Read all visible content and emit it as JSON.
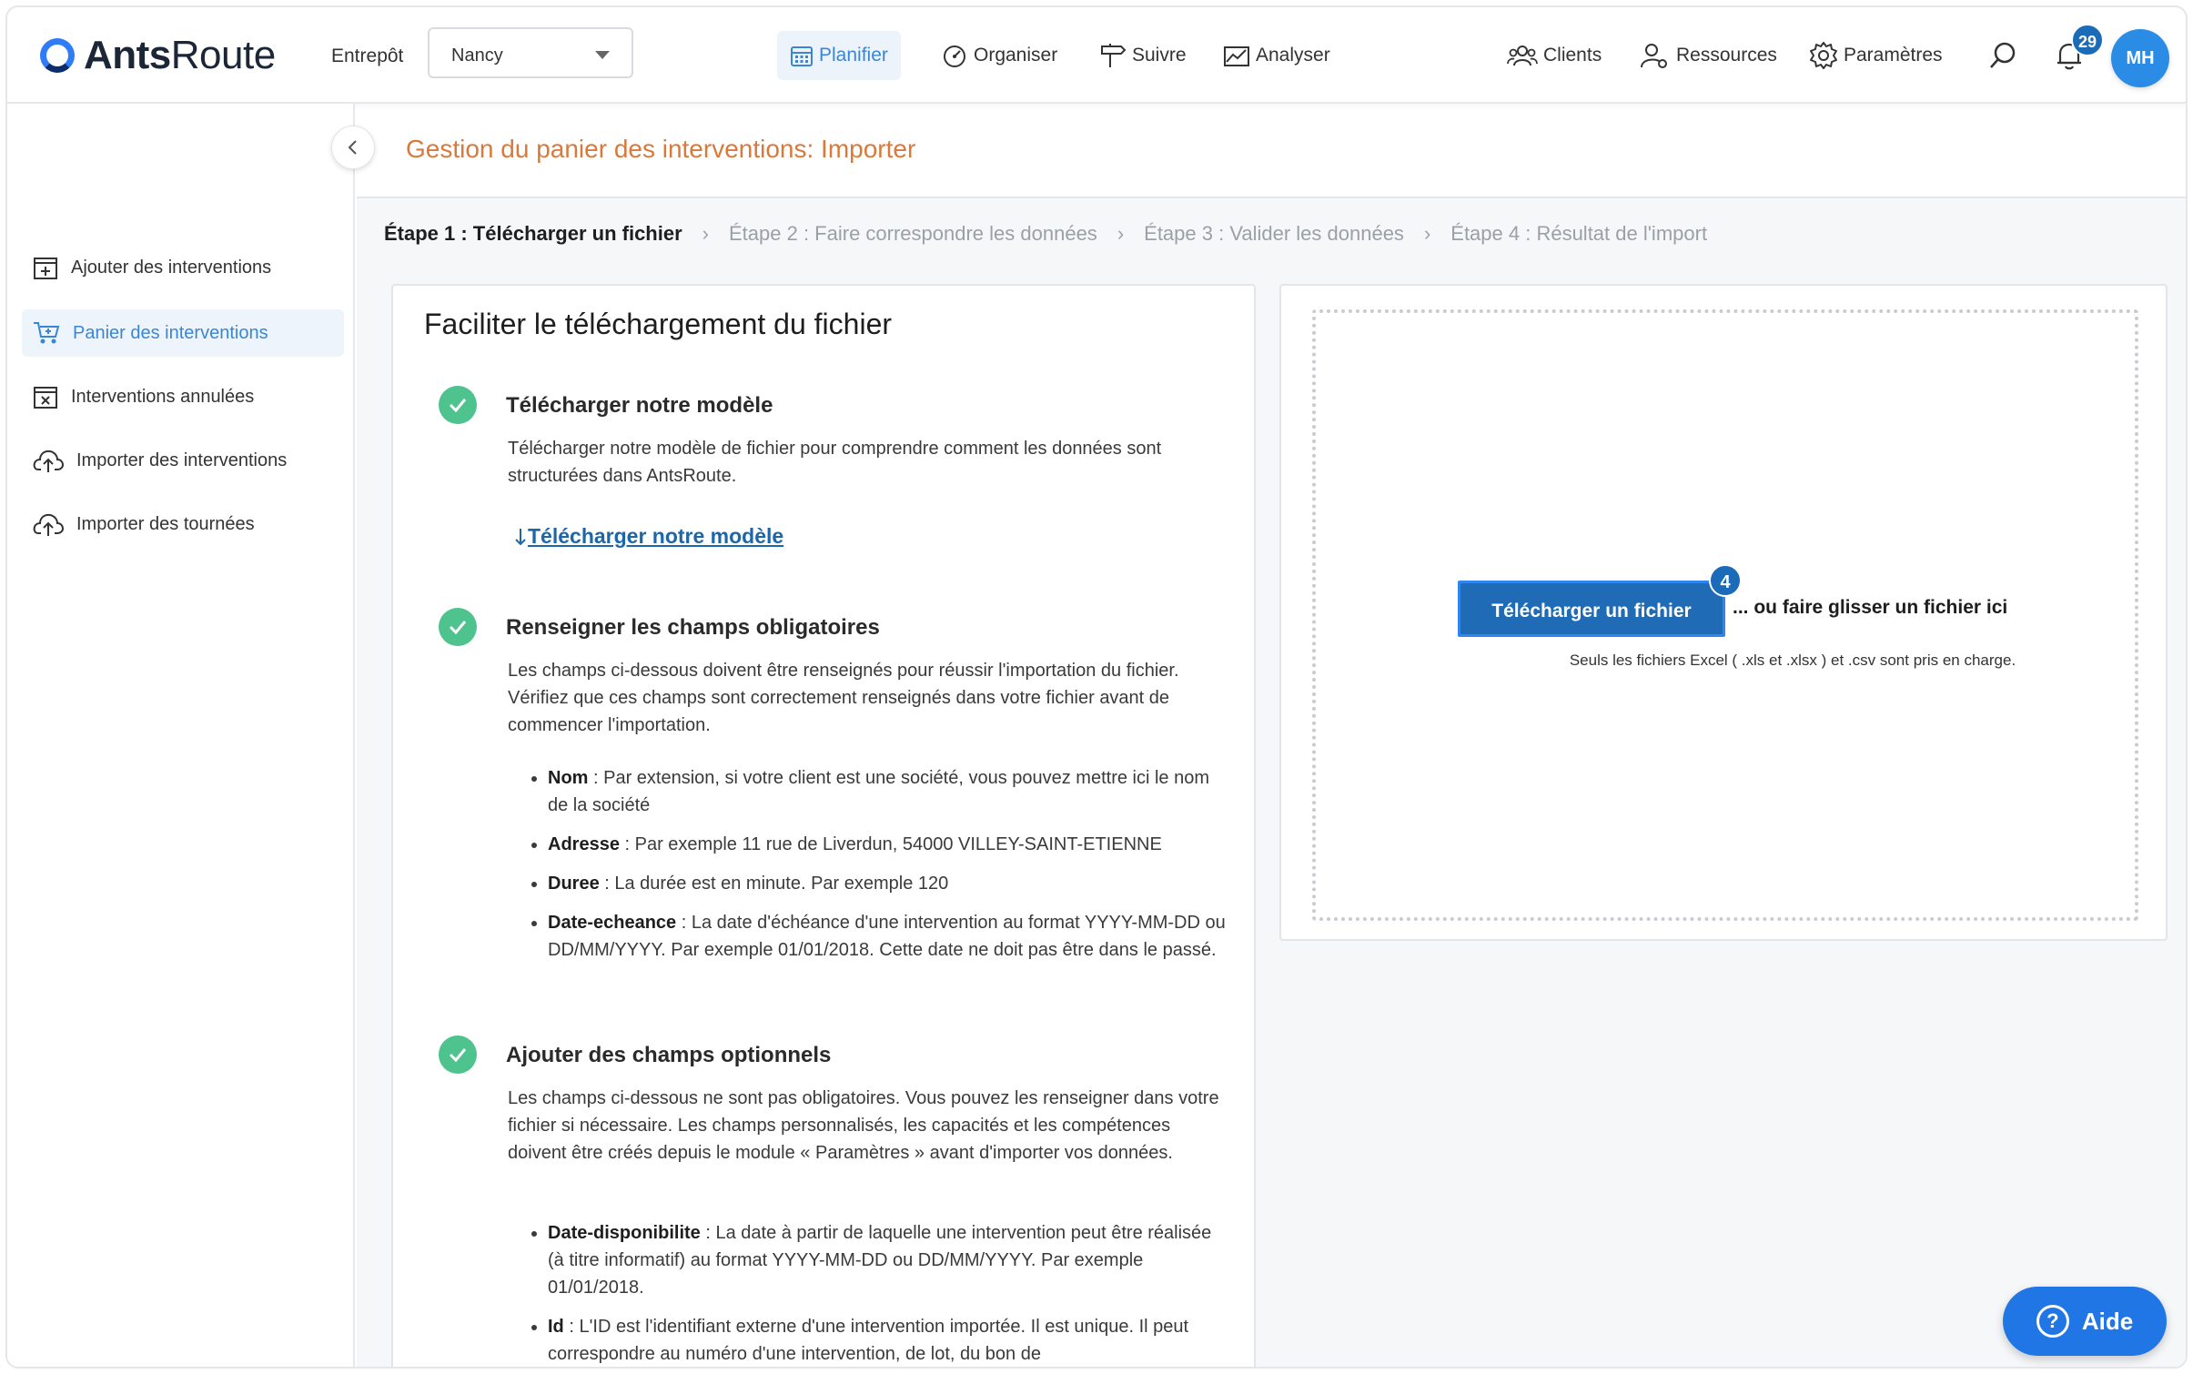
{
  "brand": {
    "name_bold": "Ants",
    "name_light": "Route"
  },
  "warehouse": {
    "label": "Entrepôt",
    "value": "Nancy"
  },
  "nav": {
    "planifier": "Planifier",
    "organiser": "Organiser",
    "suivre": "Suivre",
    "analyser": "Analyser",
    "clients": "Clients",
    "ressources": "Ressources",
    "parametres": "Paramètres"
  },
  "notifications": {
    "count": "29"
  },
  "user": {
    "initials": "MH"
  },
  "sidebar": {
    "items": [
      {
        "label": "Ajouter des interventions"
      },
      {
        "label": "Panier des interventions"
      },
      {
        "label": "Interventions annulées"
      },
      {
        "label": "Importer des interventions"
      },
      {
        "label": "Importer des tournées"
      }
    ]
  },
  "page": {
    "title": "Gestion du panier des interventions: Importer"
  },
  "steps": [
    "Étape 1 : Télécharger un fichier",
    "Étape 2 : Faire correspondre les données",
    "Étape 3 : Valider les données",
    "Étape 4 : Résultat de l'import"
  ],
  "guide": {
    "title": "Faciliter le téléchargement du fichier",
    "s1": {
      "title": "Télécharger notre modèle",
      "text": "Télécharger notre modèle de fichier pour comprendre comment les données sont structurées dans AntsRoute.",
      "link": "Télécharger notre modèle"
    },
    "s2": {
      "title": "Renseigner les champs obligatoires",
      "text": "Les champs ci-dessous doivent être renseignés pour réussir l'importation du fichier. Vérifiez que ces champs sont correctement renseignés dans votre fichier avant de commencer l'importation.",
      "fields": [
        {
          "name": "Nom",
          "desc": " : Par extension, si votre client est une société, vous pouvez mettre ici le nom de la société"
        },
        {
          "name": "Adresse",
          "desc": " : Par exemple 11 rue de Liverdun, 54000 VILLEY-SAINT-ETIENNE"
        },
        {
          "name": "Duree",
          "desc": " : La durée est en minute. Par exemple 120"
        },
        {
          "name": "Date-echeance",
          "desc": " : La date d'échéance d'une intervention au format YYYY-MM-DD ou DD/MM/YYYY. Par exemple 01/01/2018. Cette date ne doit pas être dans le passé."
        }
      ]
    },
    "s3": {
      "title": "Ajouter des champs optionnels",
      "text": "Les champs ci-dessous ne sont pas obligatoires. Vous pouvez les renseigner dans votre fichier si nécessaire. Les champs personnalisés, les capacités et les compétences doivent être créés depuis le module « Paramètres » avant d'importer vos données.",
      "fields": [
        {
          "name": "Date-disponibilite",
          "desc": " : La date à partir de laquelle une intervention peut être réalisée (à titre informatif) au format YYYY-MM-DD ou DD/MM/YYYY. Par exemple 01/01/2018."
        },
        {
          "name": "Id",
          "desc": " : L'ID est l'identifiant externe d'une intervention importée. Il est unique. Il peut correspondre au numéro d'une intervention, de lot, du bon de"
        }
      ]
    }
  },
  "upload": {
    "button": "Télécharger un fichier",
    "badge": "4",
    "or_drag": "... ou faire glisser un fichier ici",
    "hint": "Seuls les fichiers Excel ( .xls et .xlsx ) et .csv sont pris en charge."
  },
  "help": {
    "label": "Aide"
  },
  "colors": {
    "accent": "#2f7cf6",
    "title_orange": "#d9793a",
    "check_green": "#4fc38d",
    "button_blue": "#1f6bb5"
  }
}
